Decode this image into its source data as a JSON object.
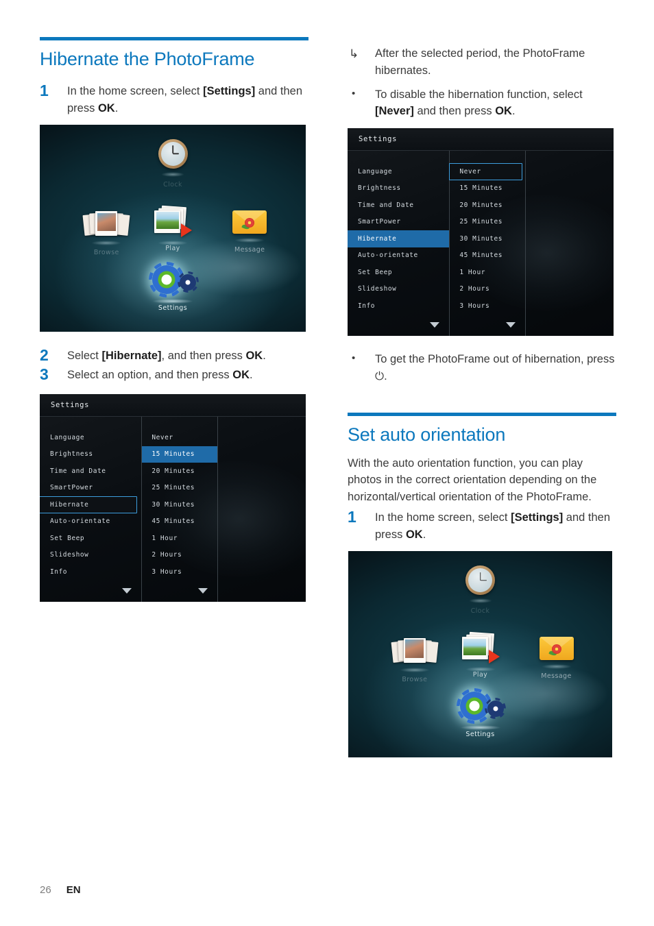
{
  "document": {
    "page_number": "26",
    "language_code": "EN"
  },
  "left_column": {
    "heading": "Hibernate the PhotoFrame",
    "steps": [
      {
        "num": "1",
        "pre": "In the home screen, select ",
        "bold": "[Settings]",
        "post": " and then press ",
        "bold2": "OK",
        "end": "."
      },
      {
        "num": "2",
        "pre": "Select ",
        "bold": "[Hibernate]",
        "post": ", and then press ",
        "bold2": "OK",
        "end": "."
      },
      {
        "num": "3",
        "pre": "Select an option, and then press ",
        "bold": "",
        "post": "",
        "bold2": "OK",
        "end": "."
      }
    ]
  },
  "right_column": {
    "bullets_top": [
      {
        "marker": "↳",
        "text": "After the selected period, the PhotoFrame hibernates."
      },
      {
        "marker": "•",
        "pre": "To disable the hibernation function, select ",
        "bold": "[Never]",
        "post": " and then press ",
        "bold2": "OK",
        "end": "."
      }
    ],
    "bullet_mid": {
      "marker": "•",
      "pre": "To get the PhotoFrame out of hibernation, press ",
      "symbol": "⏻",
      "end": "."
    },
    "heading": "Set auto orientation",
    "paragraph": "With the auto orientation function, you can play photos in the correct orientation depending on the horizontal/vertical orientation of the PhotoFrame.",
    "step": {
      "num": "1",
      "pre": "In the home screen, select ",
      "bold": "[Settings]",
      "post": " and then press ",
      "bold2": "OK",
      "end": "."
    }
  },
  "home_screen": {
    "icons": [
      {
        "name": "clock",
        "label": "Clock"
      },
      {
        "name": "browse",
        "label": "Browse"
      },
      {
        "name": "play",
        "label": "Play"
      },
      {
        "name": "message",
        "label": "Message"
      },
      {
        "name": "settings",
        "label": "Settings"
      }
    ]
  },
  "settings_screen": {
    "title": "Settings",
    "menu_items": [
      "Language",
      "Brightness",
      "Time and Date",
      "SmartPower",
      "Hibernate",
      "Auto-orientate",
      "Set Beep",
      "Slideshow",
      "Info"
    ],
    "option_items": [
      "Never",
      "15 Minutes",
      "20 Minutes",
      "25 Minutes",
      "30 Minutes",
      "45 Minutes",
      "1 Hour",
      "2 Hours",
      "3 Hours"
    ],
    "variant_left": {
      "menu_focused": "Hibernate",
      "option_highlighted": "15 Minutes"
    },
    "variant_right": {
      "menu_highlighted": "Hibernate",
      "option_focused": "Never"
    }
  },
  "colors": {
    "accent_blue": "#0c78bd",
    "menu_highlight": "#1f6ba8",
    "focus_outline": "#3d9ede",
    "text_body": "#3b3b3b"
  }
}
